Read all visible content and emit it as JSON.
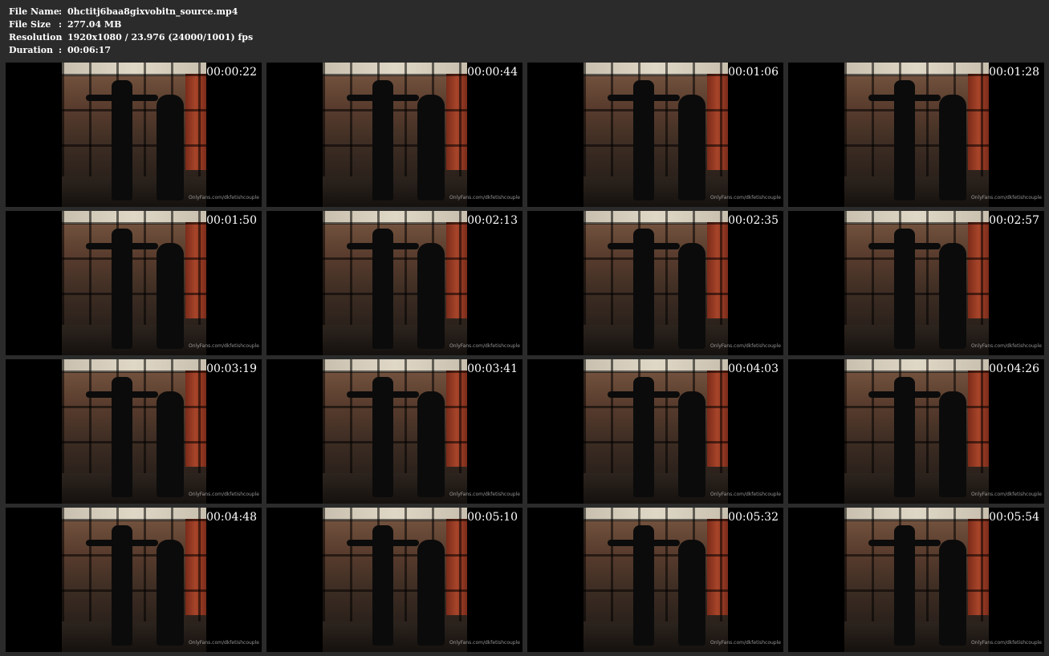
{
  "info": {
    "file_name": {
      "label": "File Name",
      "value": "0hctitj6baa8gixvobitn_source.mp4"
    },
    "file_size": {
      "label": "File Size",
      "value": "277.04 MB"
    },
    "resolution": {
      "label": "Resolution",
      "value": "1920x1080 / 23.976 (24000/1001) fps"
    },
    "duration": {
      "label": "Duration",
      "value": "00:06:17"
    },
    "separator": ":"
  },
  "watermark": "OnlyFans.com/dkfetishcouple",
  "thumbnails": [
    {
      "time": "00:00:22"
    },
    {
      "time": "00:00:44"
    },
    {
      "time": "00:01:06"
    },
    {
      "time": "00:01:28"
    },
    {
      "time": "00:01:50"
    },
    {
      "time": "00:02:13"
    },
    {
      "time": "00:02:35"
    },
    {
      "time": "00:02:57"
    },
    {
      "time": "00:03:19"
    },
    {
      "time": "00:03:41"
    },
    {
      "time": "00:04:03"
    },
    {
      "time": "00:04:26"
    },
    {
      "time": "00:04:48"
    },
    {
      "time": "00:05:10"
    },
    {
      "time": "00:05:32"
    },
    {
      "time": "00:05:54"
    }
  ]
}
